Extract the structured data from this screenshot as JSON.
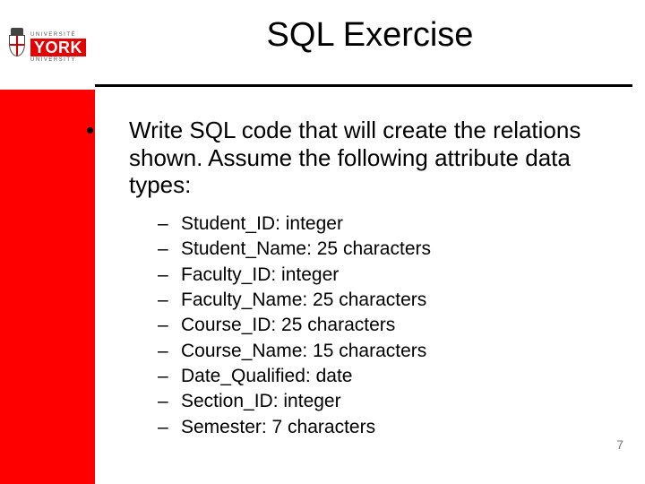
{
  "logo": {
    "top_text": "UNIVERSITÉ",
    "main": "YORK",
    "bottom_text": "UNIVERSITY"
  },
  "title": "SQL Exercise",
  "lead": "Write SQL code that will create the relations shown. Assume the following attribute data types:",
  "items": [
    "Student_ID: integer",
    "Student_Name: 25 characters",
    "Faculty_ID: integer",
    "Faculty_Name: 25 characters",
    "Course_ID: 25 characters",
    "Course_Name: 15 characters",
    "Date_Qualified: date",
    "Section_ID: integer",
    "Semester: 7 characters"
  ],
  "page_number": "7"
}
